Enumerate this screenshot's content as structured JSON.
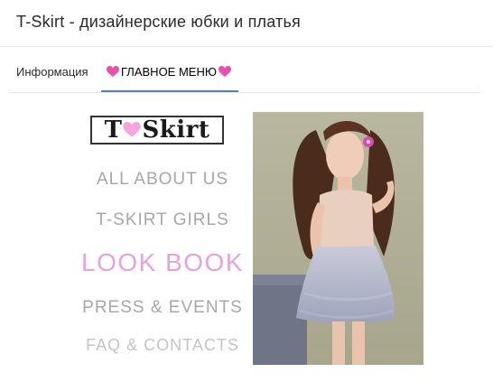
{
  "header": {
    "title": "T-Skirt - дизайнерские юбки и платья"
  },
  "tabs": [
    {
      "label": "Информация",
      "active": false
    },
    {
      "label": "ГЛАВНОЕ МЕНЮ",
      "active": true,
      "icon": "pink-heart-icon"
    }
  ],
  "menu": {
    "logo_text_left": "T",
    "logo_text_right": "Skirt",
    "items": [
      "ALL ABOUT US",
      "T-SKIRT GIRLS",
      "LOOK BOOK",
      "PRESS & EVENTS",
      "FAQ & CONTACTS"
    ]
  },
  "colors": {
    "accent_tab_underline": "#5181b8",
    "menu_text": "#a7a7a7",
    "menu_highlight": "#e6a3d9",
    "heart": "#e84fb0"
  }
}
